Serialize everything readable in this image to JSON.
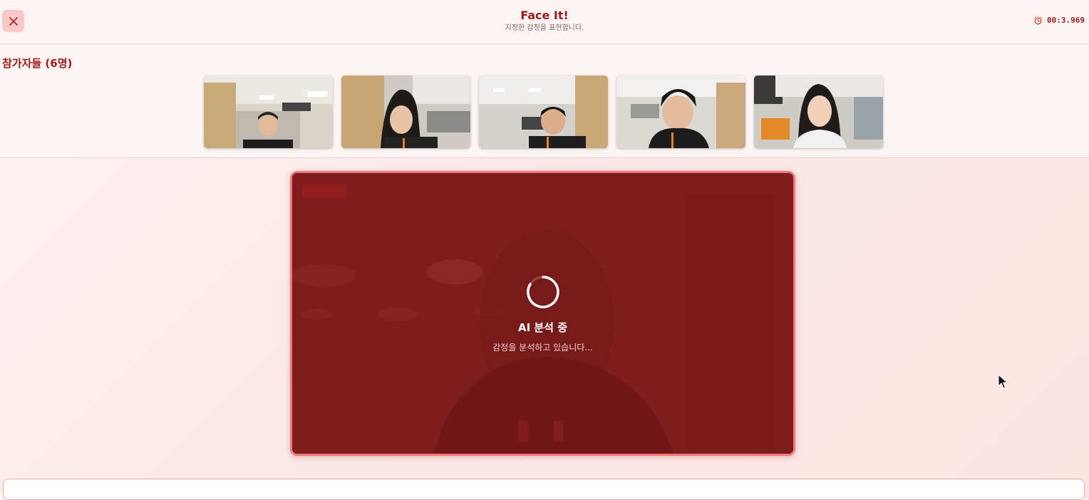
{
  "header": {
    "title": "Face It!",
    "subtitle": "지정한 감정을 표현합니다.",
    "timer": "00:3.969",
    "timer_icon": "alarm-clock-icon",
    "close_icon": "close-icon"
  },
  "participants": {
    "title": "참가자들 (6명)",
    "thumbnails": [
      {
        "label": "participant-1"
      },
      {
        "label": "participant-2"
      },
      {
        "label": "participant-3"
      },
      {
        "label": "participant-4"
      },
      {
        "label": "participant-5"
      }
    ]
  },
  "main": {
    "analysis_title": "AI 분석 중",
    "analysis_subtitle": "감정을 분석하고 있습니다...",
    "spinner_icon": "loading-spinner-icon"
  },
  "colors": {
    "accent": "#9b1b1b",
    "video_bg": "#7e1c1c",
    "video_border": "#f07878",
    "page_bg": "#fbe7e7"
  }
}
